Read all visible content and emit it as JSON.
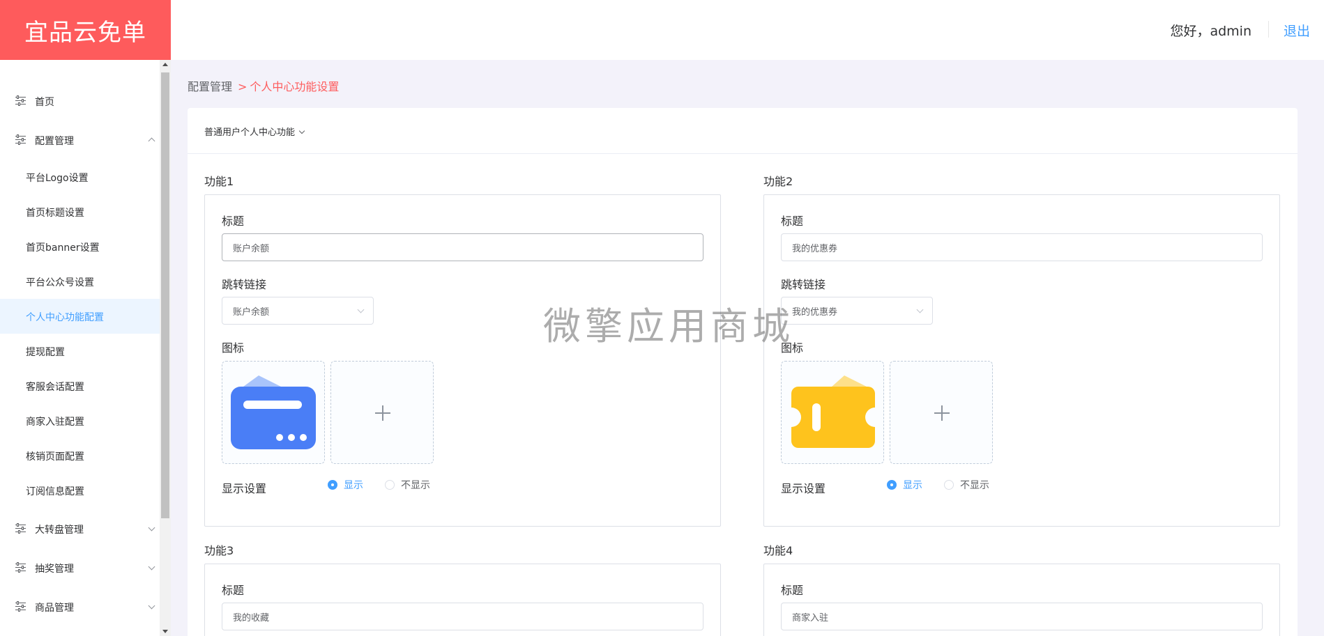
{
  "app": {
    "title": "宜品云免单"
  },
  "header": {
    "greeting": "您好，admin",
    "logout": "退出"
  },
  "sidebar": {
    "items": [
      {
        "label": "首页"
      },
      {
        "label": "配置管理"
      },
      {
        "label": "平台Logo设置"
      },
      {
        "label": "首页标题设置"
      },
      {
        "label": "首页banner设置"
      },
      {
        "label": "平台公众号设置"
      },
      {
        "label": "个人中心功能配置",
        "active": true
      },
      {
        "label": "提现配置"
      },
      {
        "label": "客服会话配置"
      },
      {
        "label": "商家入驻配置"
      },
      {
        "label": "核销页面配置"
      },
      {
        "label": "订阅信息配置"
      },
      {
        "label": "大转盘管理"
      },
      {
        "label": "抽奖管理"
      },
      {
        "label": "商品管理"
      }
    ]
  },
  "breadcrumb": {
    "parent": "配置管理",
    "separator": ">",
    "current": "个人中心功能设置"
  },
  "panel": {
    "selector": "普通用户个人中心功能"
  },
  "labels": {
    "title": "标题",
    "link": "跳转链接",
    "icon": "图标",
    "display": "显示设置",
    "show": "显示",
    "hide": "不显示"
  },
  "functions": [
    {
      "name": "功能1",
      "title_value": "账户余额",
      "link_value": "账户余额",
      "icon": "wallet-card-icon",
      "icon_color": "#4a7ef6",
      "display": "显示"
    },
    {
      "name": "功能2",
      "title_value": "我的优惠券",
      "link_value": "我的优惠券",
      "icon": "coupon-ticket-icon",
      "icon_color": "#fec31d",
      "display": "显示"
    },
    {
      "name": "功能3",
      "title_value": "我的收藏"
    },
    {
      "name": "功能4",
      "title_value": "商家入驻"
    }
  ],
  "watermark": "微擎应用商城",
  "colors": {
    "brand": "#fe5b5c",
    "primary": "#409eff",
    "background": "#f3f2fa"
  }
}
